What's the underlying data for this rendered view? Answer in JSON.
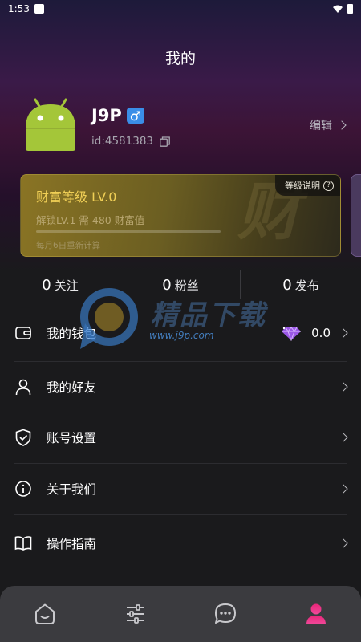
{
  "status_bar": {
    "time": "1:53"
  },
  "page": {
    "title": "我的"
  },
  "profile": {
    "username": "J9P",
    "gender_symbol": "♂",
    "user_id": "id:4581383",
    "edit_label": "编辑"
  },
  "wealth_card": {
    "title": "财富等级 LV.0",
    "explain_label": "等级说明",
    "unlock_text": "解锁LV.1 需 480 财富值",
    "reset_text": "每月6日重新计算",
    "progress": 0,
    "watermark_char": "财"
  },
  "stats": [
    {
      "num": "0",
      "label": "关注"
    },
    {
      "num": "0",
      "label": "粉丝"
    },
    {
      "num": "0",
      "label": "发布"
    }
  ],
  "menu": {
    "wallet": {
      "label": "我的钱包",
      "value": "0.0"
    },
    "friends": {
      "label": "我的好友"
    },
    "account": {
      "label": "账号设置"
    },
    "about": {
      "label": "关于我们"
    },
    "guide": {
      "label": "操作指南"
    }
  },
  "watermark": {
    "text": "精品下载",
    "url": "www.j9p.com"
  },
  "tabbar": {
    "tabs": [
      {
        "icon": "home-icon",
        "active": false
      },
      {
        "icon": "sliders-icon",
        "active": false
      },
      {
        "icon": "chat-icon",
        "active": false
      },
      {
        "icon": "profile-icon",
        "active": true
      }
    ]
  },
  "colors": {
    "accent_gold": "#f0cf56",
    "tab_active": "#e8267a",
    "tab_inactive": "#c8c8cc"
  }
}
